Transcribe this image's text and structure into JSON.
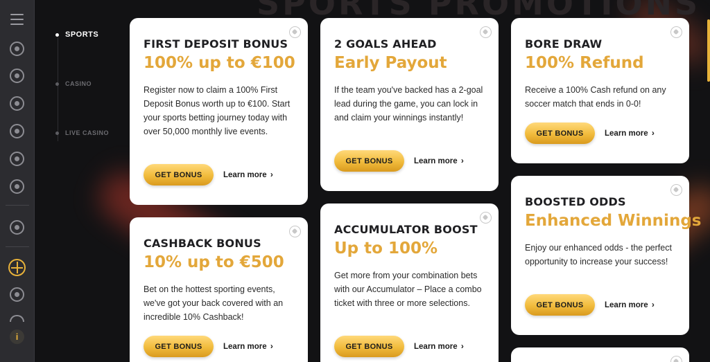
{
  "page": {
    "background_title": "SPORTS PROMOTIONS",
    "accent_color": "#e3a73a"
  },
  "rail": {
    "icons": [
      "menu-icon",
      "wallet-icon",
      "soccer-icon",
      "club-icon",
      "wheel-icon",
      "wifi-icon",
      "globe-icon",
      "shield-icon",
      "promotions-icon",
      "star-icon",
      "info-icon"
    ],
    "info_label": "i"
  },
  "categories": [
    {
      "label": "SPORTS",
      "active": true
    },
    {
      "label": "CASINO",
      "active": false
    },
    {
      "label": "LIVE CASINO",
      "active": false
    }
  ],
  "cards": [
    {
      "title": "FIRST DEPOSIT BONUS",
      "sub": "100% up to €100",
      "desc": "Register now to claim a 100% First Deposit Bonus worth up to €100. Start your sports betting journey today with over 50,000 monthly live events.",
      "button": "GET BONUS",
      "learn": "Learn more"
    },
    {
      "title": "2 GOALS AHEAD",
      "sub": "Early Payout",
      "desc": "If the team you've backed has a 2-goal lead during the game, you can lock in and claim your winnings instantly!",
      "button": "GET BONUS",
      "learn": "Learn more"
    },
    {
      "title": "BORE DRAW",
      "sub": "100% Refund",
      "desc": "Receive a 100% Cash refund on any soccer match that ends in 0-0!",
      "button": "GET BONUS",
      "learn": "Learn more"
    },
    {
      "title": "CASHBACK BONUS",
      "sub": "10% up to €500",
      "desc": "Bet on the hottest sporting events, we've got your back covered with an incredible 10% Cashback!",
      "button": "GET BONUS",
      "learn": "Learn more"
    },
    {
      "title": "ACCUMULATOR BOOST",
      "sub": "Up to 100%",
      "desc": "Get more from your combination bets with our Accumulator – Place a combo ticket with three or more selections.",
      "button": "GET BONUS",
      "learn": "Learn more"
    },
    {
      "title": "BOOSTED ODDS",
      "sub": "Enhanced Winnings",
      "desc": "Enjoy our enhanced odds - the perfect opportunity to increase your success!",
      "button": "GET BONUS",
      "learn": "Learn more"
    }
  ],
  "chevron": "›"
}
